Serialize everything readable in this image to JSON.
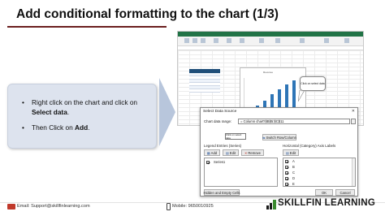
{
  "slide": {
    "title": "Add conditional formatting to the chart (1/3)",
    "bullets": [
      {
        "text_before": "Right click on the chart and click on ",
        "bold": "Select data",
        "text_after": "."
      },
      {
        "text_before": "Then Click on ",
        "bold": "Add",
        "text_after": "."
      }
    ],
    "bullet_glyph": "•"
  },
  "excel_screenshot": {
    "callout": "Click on select data",
    "chart_title": "Revenue"
  },
  "dialog": {
    "title": "Select Data Source",
    "close_glyph": "✕",
    "range_label": "Chart data range:",
    "range_value": "= Column chart'!$B$5:$C$11",
    "tooltip": "Click on select data",
    "switch_button": "Switch Row/Column",
    "legend_label": "Legend Entries (Series)",
    "axis_label": "Horizontal (Category) Axis Labels",
    "add_button": "Add",
    "edit_button": "Edit",
    "remove_button": "Remove",
    "axis_edit_button": "Edit",
    "series": [
      "Series1"
    ],
    "categories": [
      "A",
      "B",
      "C",
      "D",
      "E"
    ],
    "hidden_cells_button": "Hidden and Empty Cells",
    "ok_button": "OK",
    "cancel_button": "Cancel"
  },
  "footer": {
    "email": "Email: Support@skillfinlearning.com",
    "phone": "Mobile: 9650010925",
    "brand": "SKILLFIN LEARNING"
  },
  "colors": {
    "title_rule": "#6b1f1f",
    "bullet_box": "#dde3ee",
    "arrow": "#b8c6dc",
    "excel_green": "#217346",
    "bar_blue": "#2e75b6",
    "brand_dark": "#1a1a1a",
    "brand_green": "#3a8a2e"
  }
}
